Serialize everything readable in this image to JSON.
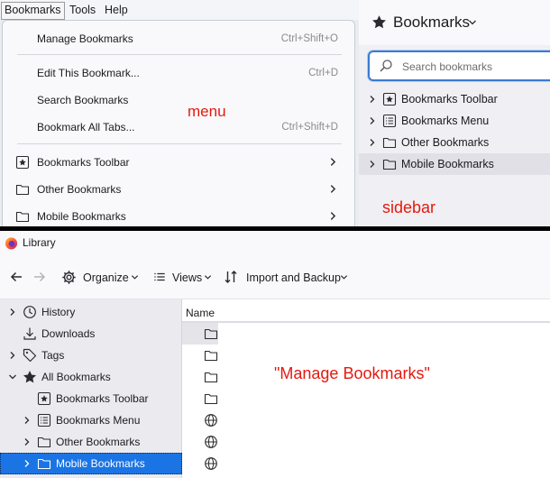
{
  "menubar": {
    "items": [
      "Bookmarks",
      "Tools",
      "Help"
    ]
  },
  "menu": {
    "items": [
      {
        "label": "Manage Bookmarks",
        "shortcut": "Ctrl+Shift+O"
      },
      {
        "label": "Edit This Bookmark...",
        "shortcut": "Ctrl+D"
      },
      {
        "label": "Search Bookmarks",
        "shortcut": ""
      },
      {
        "label": "Bookmark All Tabs...",
        "shortcut": "Ctrl+Shift+D"
      },
      {
        "label": "Bookmarks Toolbar",
        "icon": "bookmark-star-icon"
      },
      {
        "label": "Other Bookmarks",
        "icon": "folder-icon"
      },
      {
        "label": "Mobile Bookmarks",
        "icon": "folder-icon"
      }
    ]
  },
  "annotations": {
    "menu": "menu",
    "sidebar": "sidebar",
    "library": "\"Manage Bookmarks\""
  },
  "sidebar": {
    "title": "Bookmarks",
    "search_placeholder": "Search bookmarks",
    "items": [
      {
        "label": "Bookmarks Toolbar",
        "icon": "bookmark-star-icon"
      },
      {
        "label": "Bookmarks Menu",
        "icon": "menu-list-icon"
      },
      {
        "label": "Other Bookmarks",
        "icon": "folder-icon"
      },
      {
        "label": "Mobile Bookmarks",
        "icon": "folder-icon",
        "selected": true
      }
    ]
  },
  "library": {
    "window_title": "Library",
    "toolbar": {
      "organize": "Organize",
      "views": "Views",
      "import_backup": "Import and Backup"
    },
    "tree": [
      {
        "label": "History",
        "icon": "clock-icon"
      },
      {
        "label": "Downloads",
        "icon": "download-icon"
      },
      {
        "label": "Tags",
        "icon": "tag-icon"
      },
      {
        "label": "All Bookmarks",
        "icon": "star-icon"
      },
      {
        "label": "Bookmarks Toolbar",
        "icon": "bookmark-star-icon"
      },
      {
        "label": "Bookmarks Menu",
        "icon": "menu-list-icon"
      },
      {
        "label": "Other Bookmarks",
        "icon": "folder-icon"
      },
      {
        "label": "Mobile Bookmarks",
        "icon": "folder-icon",
        "selected": true
      }
    ],
    "list_header": "Name",
    "list_icons": [
      "folder-icon",
      "folder-icon",
      "folder-icon",
      "folder-icon",
      "globe-icon",
      "globe-icon",
      "globe-icon"
    ]
  },
  "colors": {
    "annotation": "#e4190e",
    "selection": "#1b74e4",
    "focus": "#3a7bd5"
  }
}
